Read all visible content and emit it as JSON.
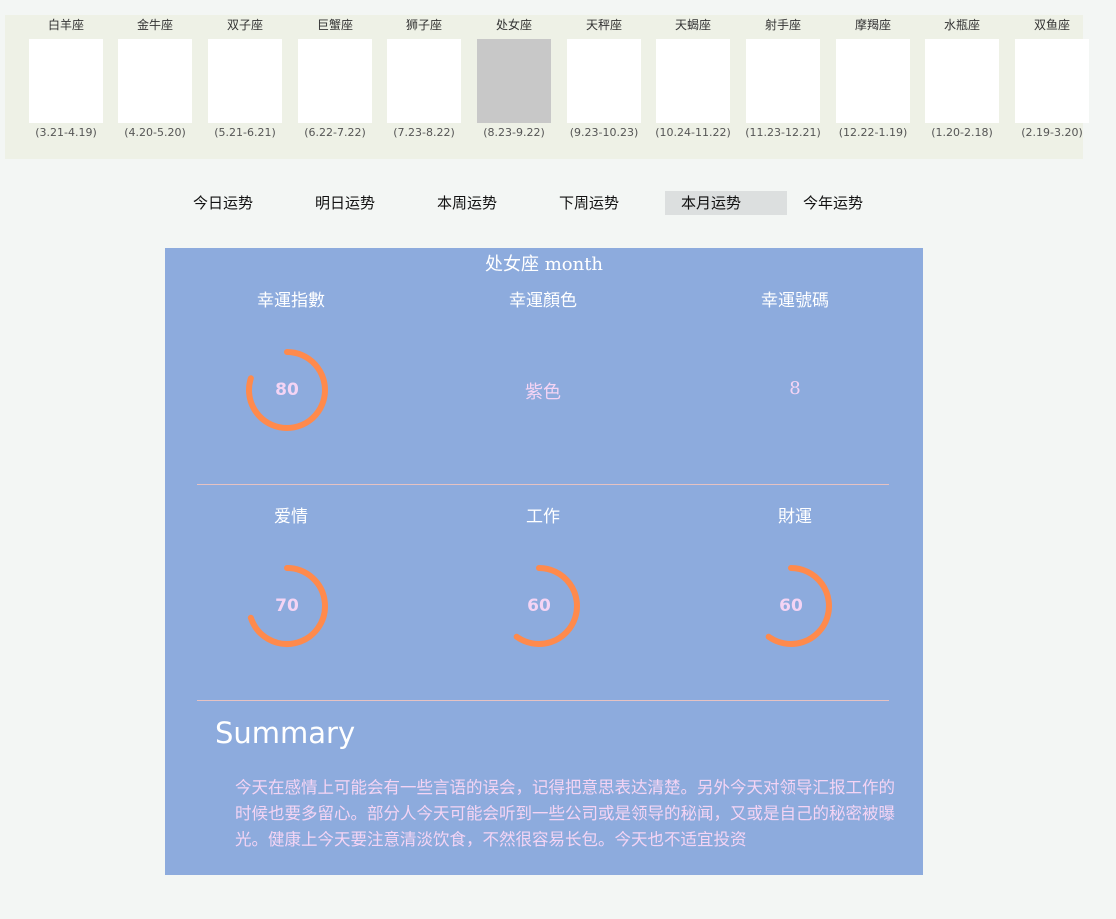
{
  "zodiac_signs": [
    {
      "name": "白羊座",
      "dates": "(3.21-4.19)",
      "icon": "aries-star-character-icon"
    },
    {
      "name": "金牛座",
      "dates": "(4.20-5.20)",
      "icon": "taurus-star-character-icon"
    },
    {
      "name": "双子座",
      "dates": "(5.21-6.21)",
      "icon": "gemini-star-character-icon"
    },
    {
      "name": "巨蟹座",
      "dates": "(6.22-7.22)",
      "icon": "cancer-star-character-icon"
    },
    {
      "name": "狮子座",
      "dates": "(7.23-8.22)",
      "icon": "leo-star-character-icon"
    },
    {
      "name": "处女座",
      "dates": "(8.23-9.22)",
      "icon": "virgo-star-character-icon",
      "selected": true
    },
    {
      "name": "天秤座",
      "dates": "(9.23-10.23)",
      "icon": "libra-star-character-icon"
    },
    {
      "name": "天蝎座",
      "dates": "(10.24-11.22)",
      "icon": "scorpio-star-character-icon"
    },
    {
      "name": "射手座",
      "dates": "(11.23-12.21)",
      "icon": "sagittarius-star-character-icon"
    },
    {
      "name": "摩羯座",
      "dates": "(12.22-1.19)",
      "icon": "capricorn-star-character-icon"
    },
    {
      "name": "水瓶座",
      "dates": "(1.20-2.18)",
      "icon": "aquarius-star-character-icon"
    },
    {
      "name": "双鱼座",
      "dates": "(2.19-3.20)",
      "icon": "pisces-star-character-icon"
    }
  ],
  "tabs": [
    {
      "label": "今日运势"
    },
    {
      "label": "明日运势"
    },
    {
      "label": "本周运势"
    },
    {
      "label": "下周运势"
    },
    {
      "label": "本月运势",
      "active": true
    },
    {
      "label": "今年运势"
    }
  ],
  "panel": {
    "title": "处女座 month",
    "lucky_index": {
      "label": "幸運指數",
      "value": 80
    },
    "lucky_color": {
      "label": "幸運顏色",
      "value": "紫色"
    },
    "lucky_number": {
      "label": "幸運號碼",
      "value": "8"
    },
    "love": {
      "label": "爱情",
      "value": 70
    },
    "work": {
      "label": "工作",
      "value": 60
    },
    "wealth": {
      "label": "財運",
      "value": 60
    },
    "summary_heading": "Summary",
    "summary_text": "今天在感情上可能会有一些言语的误会，记得把意思表达清楚。另外今天对领导汇报工作的时候也要多留心。部分人今天可能会听到一些公司或是领导的秘闻，又或是自己的秘密被曝光。健康上今天要注意清淡饮食，不然很容易长包。今天也不适宜投资"
  },
  "colors": {
    "panel_background": "#8dabdd",
    "gauge_arc": "#ff8a4c",
    "value_text": "#f4d4f4",
    "active_tab": "#dcdfdf"
  }
}
